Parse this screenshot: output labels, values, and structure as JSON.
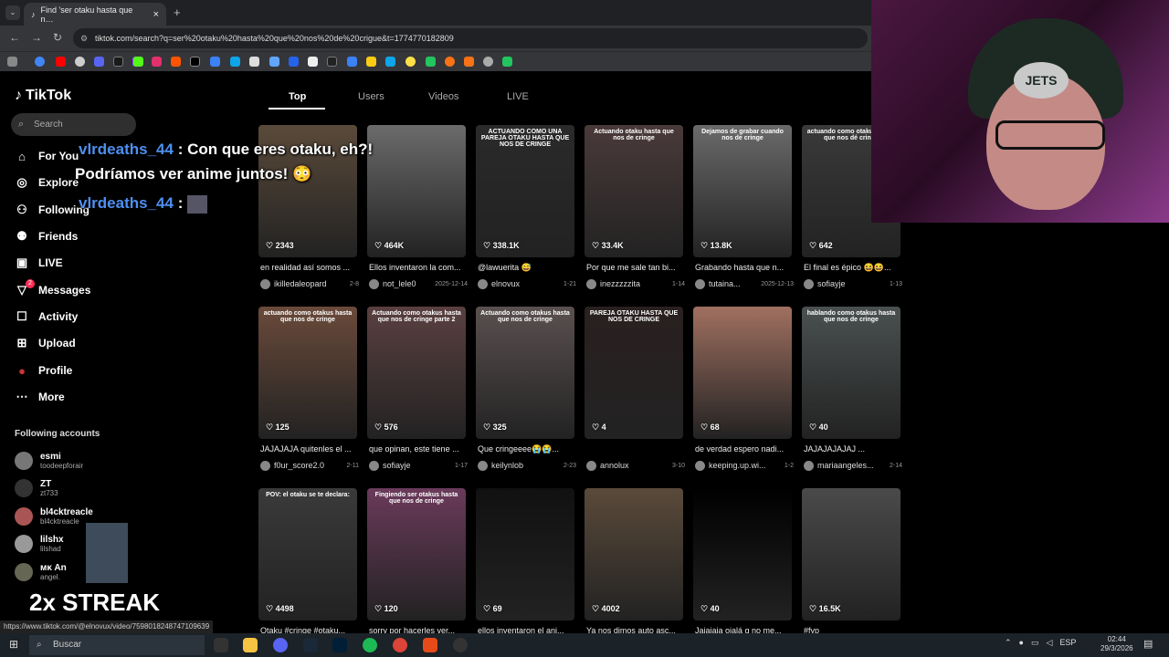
{
  "browser": {
    "tab_title": "Find 'ser otaku hasta que n…",
    "url": "tiktok.com/search?q=ser%20otaku%20hasta%20que%20nos%20de%20crigue&t=1774770182809",
    "status_url": "https://www.tiktok.com/@elnovux/video/7598018248747109639"
  },
  "sidebar": {
    "brand": "TikTok",
    "search_placeholder": "Search",
    "items": [
      {
        "label": "For You"
      },
      {
        "label": "Explore"
      },
      {
        "label": "Following"
      },
      {
        "label": "Friends"
      },
      {
        "label": "LIVE"
      },
      {
        "label": "Messages",
        "badge": "2"
      },
      {
        "label": "Activity"
      },
      {
        "label": "Upload"
      },
      {
        "label": "Profile"
      },
      {
        "label": "More"
      }
    ],
    "following_header": "Following accounts",
    "accounts": [
      {
        "name": "esmi",
        "handle": "toodeepforair"
      },
      {
        "name": "ZT",
        "handle": "zt733"
      },
      {
        "name": "bl4cktreacle",
        "handle": "bl4cktreacle"
      },
      {
        "name": "lilshx",
        "handle": "lilshad"
      },
      {
        "name": "ᴍᴋ An",
        "handle": "angel."
      }
    ]
  },
  "tabs": [
    "Top",
    "Users",
    "Videos",
    "LIVE"
  ],
  "videos": [
    {
      "likes": "2343",
      "caption": "en realidad así somos ...",
      "user": "ikilledaleopard",
      "date": "2-8"
    },
    {
      "likes": "464K",
      "caption": "Ellos inventaron la com...",
      "user": "not_lele0",
      "date": "2025-12-14"
    },
    {
      "likes": "338.1K",
      "caption": "@lawuerita 😅",
      "user": "elnovux",
      "date": "1-21",
      "overlay": "ACTUANDO COMO UNA PAREJA OTAKU HASTA QUE NOS DE CRINGE"
    },
    {
      "likes": "33.4K",
      "caption": "Por que me sale tan bi...",
      "user": "inezzzzzita",
      "date": "1-14",
      "overlay": "Actuando otaku hasta que nos de cringe"
    },
    {
      "likes": "13.8K",
      "caption": "Grabando hasta que n...",
      "user": "tutaina...",
      "date": "2025-12-13",
      "overlay": "Dejamos de grabar cuando nos de cringe"
    },
    {
      "likes": "642",
      "caption": "El final es épico 😆😆...",
      "user": "sofiayje",
      "date": "1-13",
      "overlay": "actuando como otakus hasta que nos dé cringe"
    },
    {
      "likes": "125",
      "caption": "JAJAJAJA quitenles el ...",
      "user": "f0ur_score2.0",
      "date": "2-11",
      "overlay": "actuando como otakus hasta que nos de cringe"
    },
    {
      "likes": "576",
      "caption": "que opinan, este tiene ...",
      "user": "sofiayje",
      "date": "1-17",
      "overlay": "Actuando como otakus hasta que nos de cringe parte 2"
    },
    {
      "likes": "325",
      "caption": "Que cringeeee😭😭...",
      "user": "keilynlob",
      "date": "2-23",
      "overlay": "Actuando como otakus hasta que nos de cringe"
    },
    {
      "likes": "4",
      "caption": "",
      "user": "annolux",
      "date": "3-10",
      "overlay": "PAREJA OTAKU HASTA QUE NOS DE CRINGE"
    },
    {
      "likes": "68",
      "caption": "de verdad espero nadi...",
      "user": "keeping.up.wi...",
      "date": "1-2"
    },
    {
      "likes": "40",
      "caption": "JAJAJAJAJAJ ...",
      "user": "mariaangeles...",
      "date": "2-14",
      "overlay": "hablando como otakus hasta que nos de cringe"
    },
    {
      "likes": "4498",
      "caption": "Otaku #cringe #otaku...",
      "user": "",
      "date": "",
      "overlay": "POV: el otaku se te declara:"
    },
    {
      "likes": "120",
      "caption": "sorry por hacerles ver...",
      "user": "",
      "date": "",
      "overlay": "Fingiendo ser otakus hasta que nos de cringe"
    },
    {
      "likes": "69",
      "caption": "ellos inventaron el ani...",
      "user": "",
      "date": ""
    },
    {
      "likes": "4002",
      "caption": "Ya nos dimos auto asc...",
      "user": "",
      "date": ""
    },
    {
      "likes": "40",
      "caption": "Jajajaja ojalá q no me...",
      "user": "",
      "date": ""
    },
    {
      "likes": "16.5K",
      "caption": "#fyp",
      "user": "",
      "date": ""
    }
  ],
  "chat": {
    "user": "vlrdeaths_44",
    "line1": ": Con que eres otaku, eh?!",
    "line2": "Podríamos ver anime juntos! 😳",
    "line3": ":"
  },
  "webcam": {
    "beanie_logo": "JETS"
  },
  "streak": "2x STREAK",
  "taskbar": {
    "search_placeholder": "Buscar",
    "lang": "ESP",
    "time": "02:44",
    "date": "29/3/2026"
  },
  "colors": {
    "accent": "#fe2c55",
    "chat_name": "#4e8ff0"
  }
}
